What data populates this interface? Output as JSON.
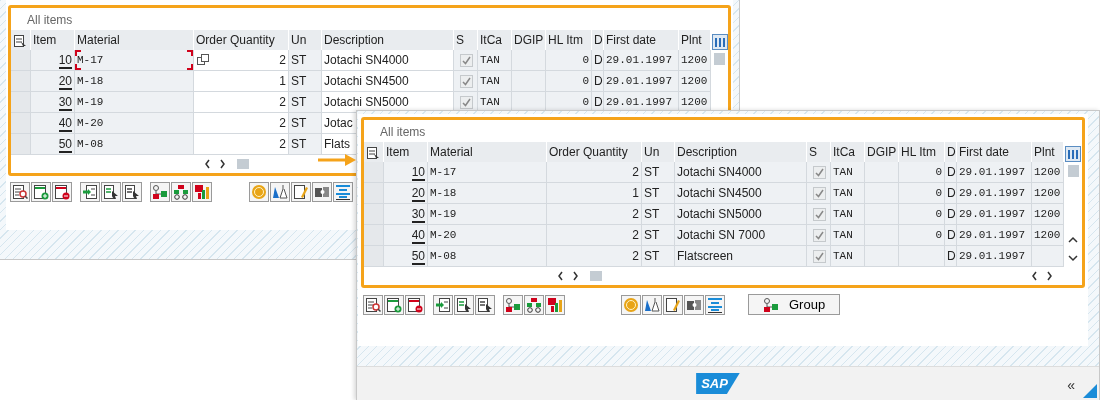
{
  "windows": [
    {
      "kind": "back",
      "panel_title": "All items",
      "columns": [
        {
          "label": "Item",
          "kind": "display"
        },
        {
          "label": "Material",
          "kind": "display"
        },
        {
          "label": "Order Quantity",
          "kind": "input"
        },
        {
          "label": "Un",
          "kind": "display"
        },
        {
          "label": "Description",
          "kind": "input"
        },
        {
          "label": "S",
          "kind": "display"
        },
        {
          "label": "ItCa",
          "kind": "display"
        },
        {
          "label": "DGIP",
          "kind": "display"
        },
        {
          "label": "HL Itm",
          "kind": "display"
        },
        {
          "label": "D",
          "kind": "display"
        },
        {
          "label": "First date",
          "kind": "display"
        },
        {
          "label": "Plnt",
          "kind": "display"
        }
      ],
      "rows": [
        {
          "item": "10",
          "material": "M-17",
          "quantity": "2",
          "unit": "ST",
          "description": "Jotachi SN4000",
          "checked": true,
          "category": "TAN",
          "hl_item": "0",
          "d": "D",
          "first_date": "29.01.1997",
          "plant": "1200",
          "focused": true
        },
        {
          "item": "20",
          "material": "M-18",
          "quantity": "1",
          "unit": "ST",
          "description": "Jotachi SN4500",
          "checked": true,
          "category": "TAN",
          "hl_item": "0",
          "d": "D",
          "first_date": "29.01.1997",
          "plant": "1200",
          "focused": false
        },
        {
          "item": "30",
          "material": "M-19",
          "quantity": "2",
          "unit": "ST",
          "description": "Jotachi SN5000",
          "checked": true,
          "category": "TAN",
          "hl_item": "0",
          "d": "D",
          "first_date": "29.01.1997",
          "plant": "1200",
          "focused": false
        },
        {
          "item": "40",
          "material": "M-20",
          "quantity": "2",
          "unit": "ST",
          "description": "Jotac",
          "focused": false
        },
        {
          "item": "50",
          "material": "M-08",
          "quantity": "2",
          "unit": "ST",
          "description": "Flats",
          "focused": false
        }
      ]
    },
    {
      "kind": "front",
      "panel_title": "All items",
      "columns": [
        {
          "label": "Item",
          "kind": "display"
        },
        {
          "label": "Material",
          "kind": "display"
        },
        {
          "label": "Order Quantity",
          "kind": "display"
        },
        {
          "label": "Un",
          "kind": "display"
        },
        {
          "label": "Description",
          "kind": "display"
        },
        {
          "label": "S",
          "kind": "display"
        },
        {
          "label": "ItCa",
          "kind": "display"
        },
        {
          "label": "DGIP",
          "kind": "display"
        },
        {
          "label": "HL Itm",
          "kind": "display"
        },
        {
          "label": "D",
          "kind": "display"
        },
        {
          "label": "First date",
          "kind": "display"
        },
        {
          "label": "Plnt",
          "kind": "display"
        }
      ],
      "rows": [
        {
          "item": "10",
          "material": "M-17",
          "quantity": "2",
          "unit": "ST",
          "description": "Jotachi SN4000",
          "checked": true,
          "category": "TAN",
          "hl_item": "0",
          "d": "D",
          "first_date": "29.01.1997",
          "plant": "1200",
          "focused": false
        },
        {
          "item": "20",
          "material": "M-18",
          "quantity": "1",
          "unit": "ST",
          "description": "Jotachi SN4500",
          "checked": true,
          "category": "TAN",
          "hl_item": "0",
          "d": "D",
          "first_date": "29.01.1997",
          "plant": "1200",
          "focused": false
        },
        {
          "item": "30",
          "material": "M-19",
          "quantity": "2",
          "unit": "ST",
          "description": "Jotachi SN5000",
          "checked": true,
          "category": "TAN",
          "hl_item": "0",
          "d": "D",
          "first_date": "29.01.1997",
          "plant": "1200",
          "focused": false
        },
        {
          "item": "40",
          "material": "M-20",
          "quantity": "2",
          "unit": "ST",
          "description": "Jotachi SN 7000",
          "checked": true,
          "category": "TAN",
          "hl_item": "0",
          "d": "D",
          "first_date": "29.01.1997",
          "plant": "1200",
          "focused": false
        },
        {
          "item": "50",
          "material": "M-08",
          "quantity": "2",
          "unit": "ST",
          "description": "Flatscreen",
          "checked": true,
          "category": "TAN",
          "d": "D",
          "first_date": "29.01.1997",
          "focused": false
        }
      ],
      "group_button": "Group",
      "logo": "SAP",
      "collapse": "«"
    }
  ]
}
